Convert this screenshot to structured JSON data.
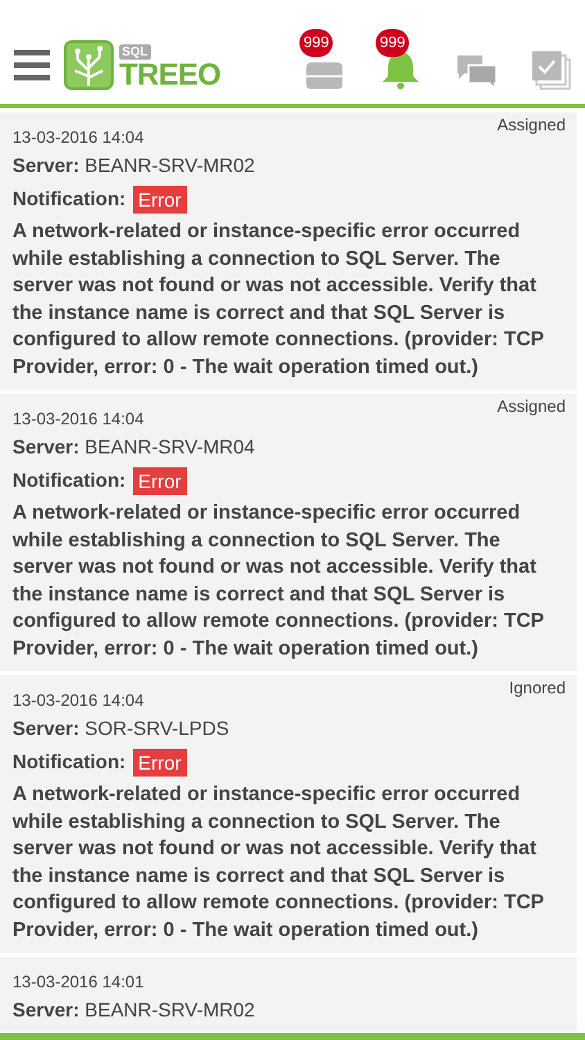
{
  "header": {
    "logo_small": "SQL",
    "logo_text": "TREEO",
    "badges": [
      {
        "kind": "inbox",
        "count": "999"
      },
      {
        "kind": "bell",
        "count": "999"
      }
    ]
  },
  "notifications": [
    {
      "date": "13-03-2016 14:04",
      "status": "Assigned",
      "server_label": "Server:",
      "server": "BEANR-SRV-MR02",
      "notification_label": "Notification:",
      "level": "Error",
      "message": "A network-related or instance-specific error occurred while establishing a connection to SQL Server. The server was not found or was not accessible. Verify that the instance name is correct and that SQL Server is configured to allow remote connections. (provider: TCP Provider, error: 0 - The wait operation timed out.)"
    },
    {
      "date": "13-03-2016 14:04",
      "status": "Assigned",
      "server_label": "Server:",
      "server": "BEANR-SRV-MR04",
      "notification_label": "Notification:",
      "level": "Error",
      "message": "A network-related or instance-specific error occurred while establishing a connection to SQL Server. The server was not found or was not accessible. Verify that the instance name is correct and that SQL Server is configured to allow remote connections. (provider: TCP Provider, error: 0 - The wait operation timed out.)"
    },
    {
      "date": "13-03-2016 14:04",
      "status": "Ignored",
      "server_label": "Server:",
      "server": "SOR-SRV-LPDS",
      "notification_label": "Notification:",
      "level": "Error",
      "message": "A network-related or instance-specific error occurred while establishing a connection to SQL Server. The server was not found or was not accessible. Verify that the instance name is correct and that SQL Server is configured to allow remote connections. (provider: TCP Provider, error: 0 - The wait operation timed out.)"
    },
    {
      "date": "13-03-2016 14:01",
      "server_label": "Server:",
      "server": "BEANR-SRV-MR02"
    }
  ]
}
